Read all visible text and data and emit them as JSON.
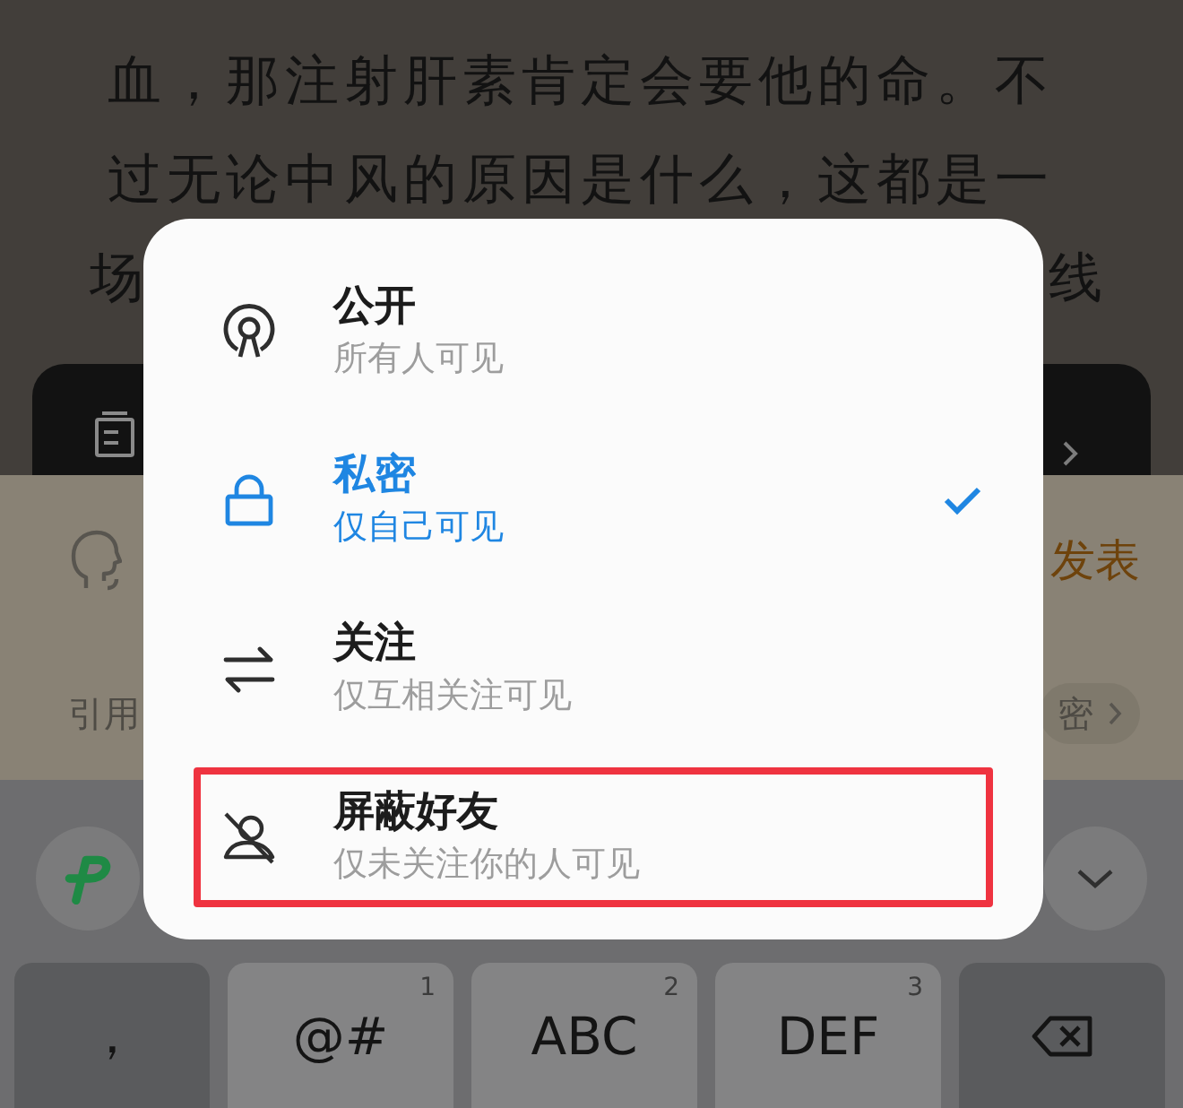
{
  "article": {
    "lines": [
      "血，那注射肝素肯定会要他的命。不",
      "过无论中风的原因是什么，这都是一"
    ],
    "covered_line": {
      "left": "场",
      "right": "线"
    }
  },
  "comment_bar": {
    "publish_button": "发表",
    "quote_button": "引用",
    "privacy_chip": "密"
  },
  "visibility_menu": {
    "options": [
      {
        "kind": "public",
        "title": "公开",
        "subtitle": "所有人可见",
        "selected": false,
        "highlighted": false
      },
      {
        "kind": "private",
        "title": "私密",
        "subtitle": "仅自己可见",
        "selected": true,
        "highlighted": false
      },
      {
        "kind": "mutual",
        "title": "关注",
        "subtitle": "仅互相关注可见",
        "selected": false,
        "highlighted": false
      },
      {
        "kind": "block",
        "title": "屏蔽好友",
        "subtitle": "仅未关注你的人可见",
        "selected": false,
        "highlighted": true
      }
    ]
  },
  "keyboard": {
    "keys": [
      {
        "kind": "punctuation",
        "label": "，"
      },
      {
        "kind": "letters",
        "label": "@#",
        "hint": "1"
      },
      {
        "kind": "letters",
        "label": "ABC",
        "hint": "2"
      },
      {
        "kind": "letters",
        "label": "DEF",
        "hint": "3"
      },
      {
        "kind": "backspace"
      }
    ]
  }
}
